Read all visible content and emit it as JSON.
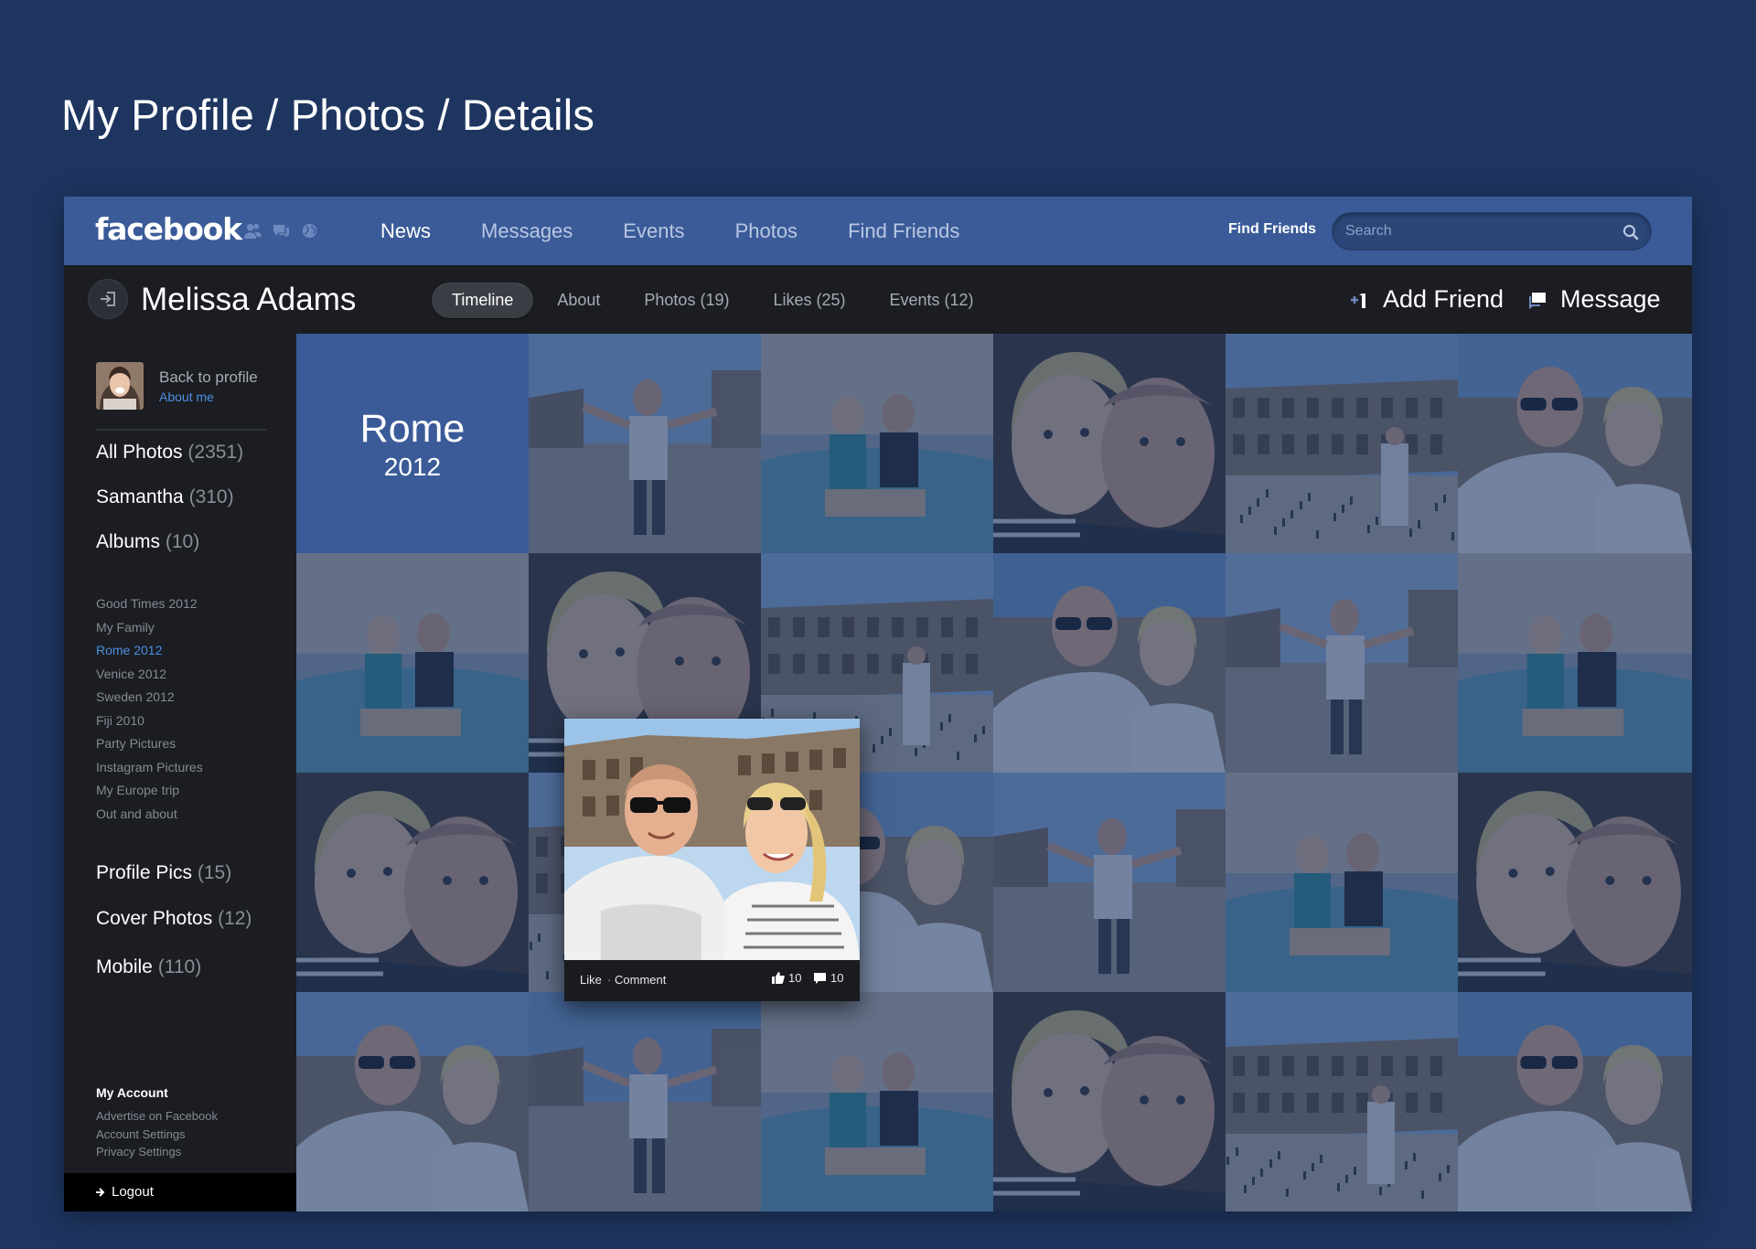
{
  "page_heading": "My Profile / Photos / Details",
  "topbar": {
    "logo": "facebook",
    "nav": [
      {
        "label": "News",
        "active": true
      },
      {
        "label": "Messages",
        "active": false
      },
      {
        "label": "Events",
        "active": false
      },
      {
        "label": "Photos",
        "active": false
      },
      {
        "label": "Find Friends",
        "active": false
      }
    ],
    "find_friends": "Find Friends",
    "search_placeholder": "Search"
  },
  "profile": {
    "name": "Melissa Adams",
    "tabs": [
      {
        "label": "Timeline",
        "active": true
      },
      {
        "label": "About",
        "active": false
      },
      {
        "label": "Photos (19)",
        "active": false
      },
      {
        "label": "Likes (25)",
        "active": false
      },
      {
        "label": "Events (12)",
        "active": false
      }
    ],
    "add_friend": "Add Friend",
    "message": "Message"
  },
  "sidebar": {
    "back_to_profile": "Back to profile",
    "about_me": "About me",
    "groups_top": [
      {
        "label": "All Photos",
        "count": "(2351)"
      },
      {
        "label": "Samantha",
        "count": "(310)"
      },
      {
        "label": "Albums",
        "count": "(10)"
      }
    ],
    "albums": [
      {
        "label": "Good Times 2012",
        "active": false
      },
      {
        "label": "My Family",
        "active": false
      },
      {
        "label": "Rome 2012",
        "active": true
      },
      {
        "label": "Venice 2012",
        "active": false
      },
      {
        "label": "Sweden 2012",
        "active": false
      },
      {
        "label": "Fiji 2010",
        "active": false
      },
      {
        "label": "Party Pictures",
        "active": false
      },
      {
        "label": "Instagram Pictures",
        "active": false
      },
      {
        "label": "My Europe trip",
        "active": false
      },
      {
        "label": "Out and about",
        "active": false
      }
    ],
    "groups_bottom": [
      {
        "label": "Profile Pics",
        "count": "(15)"
      },
      {
        "label": "Cover Photos",
        "count": "(12)"
      },
      {
        "label": "Mobile",
        "count": "(110)"
      }
    ],
    "account_title": "My Account",
    "account_links": [
      "Advertise on Facebook",
      "Account Settings",
      "Privacy Settings"
    ],
    "logout": "Logout"
  },
  "album_tile": {
    "title": "Rome",
    "year": "2012"
  },
  "featured": {
    "like": "Like",
    "separator": "·",
    "comment": "Comment",
    "likes_count": "10",
    "comments_count": "10"
  },
  "colors": {
    "page_bg": "#1e3560",
    "facebook_blue": "#3b5b98",
    "dark_panel": "#1b1d22",
    "link_blue": "#4c8fe1",
    "grid_overlay": "#203868"
  },
  "icons": [
    "friends-icon",
    "messages-icon",
    "globe-icon",
    "search-icon",
    "back-icon",
    "add-friend-icon",
    "message-icon",
    "logout-arrow-icon",
    "thumbs-up-icon",
    "comment-icon"
  ]
}
